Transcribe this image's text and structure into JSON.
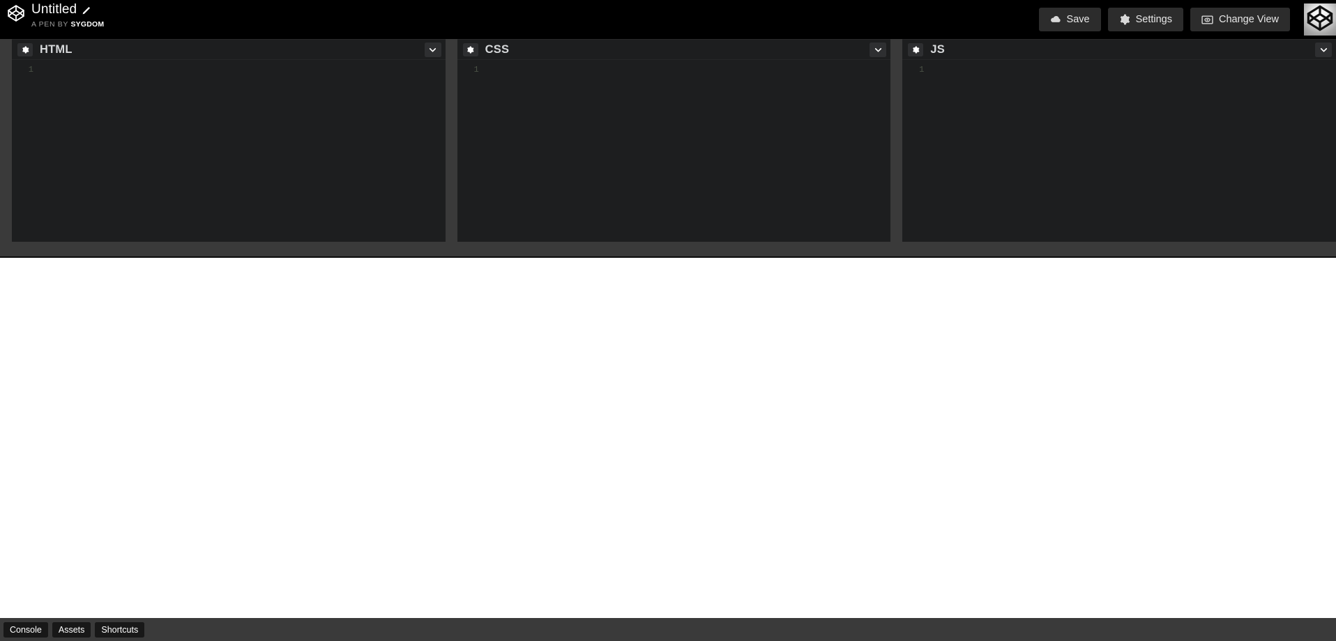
{
  "header": {
    "logo_icon": "codepen-logo-icon",
    "pen_title": "Untitled",
    "edit_icon": "pencil-icon",
    "byline_prefix": "A PEN BY ",
    "byline_author": "Sygdom",
    "buttons": [
      {
        "label": "Save",
        "icon": "cloud-icon",
        "name": "save-button"
      },
      {
        "label": "Settings",
        "icon": "gear-icon",
        "name": "settings-button"
      },
      {
        "label": "Change View",
        "icon": "view-icon",
        "name": "change-view-button"
      }
    ],
    "avatar_icon": "codepen-avatar-icon"
  },
  "editors": [
    {
      "label": "HTML",
      "settings_icon": "gear-icon",
      "collapse_icon": "chevron-down-icon",
      "line_numbers": "1",
      "code": ""
    },
    {
      "label": "CSS",
      "settings_icon": "gear-icon",
      "collapse_icon": "chevron-down-icon",
      "line_numbers": "1",
      "code": ""
    },
    {
      "label": "JS",
      "settings_icon": "gear-icon",
      "collapse_icon": "chevron-down-icon",
      "line_numbers": "1",
      "code": ""
    }
  ],
  "preview": {
    "content": ""
  },
  "footer": {
    "buttons": [
      {
        "label": "Console",
        "name": "console-button"
      },
      {
        "label": "Assets",
        "name": "assets-button"
      },
      {
        "label": "Shortcuts",
        "name": "shortcuts-button"
      }
    ]
  },
  "colors": {
    "topbar_bg": "#000000",
    "chrome_bg": "#3a3a3a",
    "editor_bg": "#1d1e1f",
    "button_bg": "#2c2c2c",
    "preview_bg": "#ffffff",
    "line_number": "#4a5145"
  }
}
